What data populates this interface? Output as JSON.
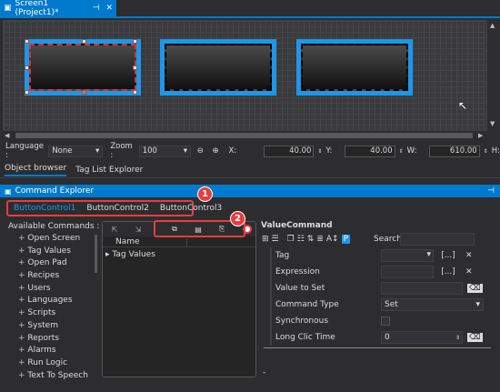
{
  "document_tab": {
    "title": "Screen1 (Project1)*",
    "pin": "⊣",
    "close": "✕"
  },
  "toolbar": {
    "language_label": "Language :",
    "language_value": "None",
    "zoom_label": "Zoom :",
    "zoom_value": "100",
    "x_label": "X:",
    "x_value": "40.00",
    "y_label": "Y:",
    "y_value": "40.00",
    "w_label": "W:",
    "w_value": "610.00",
    "h_label": "H:"
  },
  "panel_tabs": [
    "Object browser",
    "Tag List Explorer"
  ],
  "command_explorer": {
    "title": "Command Explorer",
    "button_tabs": [
      "ButtonControl1",
      "ButtonControl2",
      "ButtonControl3"
    ],
    "badge1": "1",
    "badge2": "2",
    "available_label": "Available Commands :",
    "commands": [
      "Open Screen",
      "Tag Values",
      "Open Pad",
      "Recipes",
      "Users",
      "Languages",
      "Scripts",
      "System",
      "Reports",
      "Alarms",
      "Run Logic",
      "Text To Speech"
    ],
    "list_header": "Name",
    "list_items": [
      "Tag Values"
    ],
    "value_command_title": "ValueCommand",
    "search_label": "Search:",
    "properties": [
      {
        "label": "Tag",
        "value": ""
      },
      {
        "label": "Expression",
        "value": ""
      },
      {
        "label": "Value to Set",
        "value": ""
      },
      {
        "label": "Command Type",
        "value": "Set"
      },
      {
        "label": "Synchronous",
        "value": ""
      },
      {
        "label": "Long Clic Time",
        "value": "0"
      }
    ]
  },
  "colors": {
    "accent": "#007acc",
    "highlight": "#e53e3e",
    "button_border": "#1c97ea"
  }
}
